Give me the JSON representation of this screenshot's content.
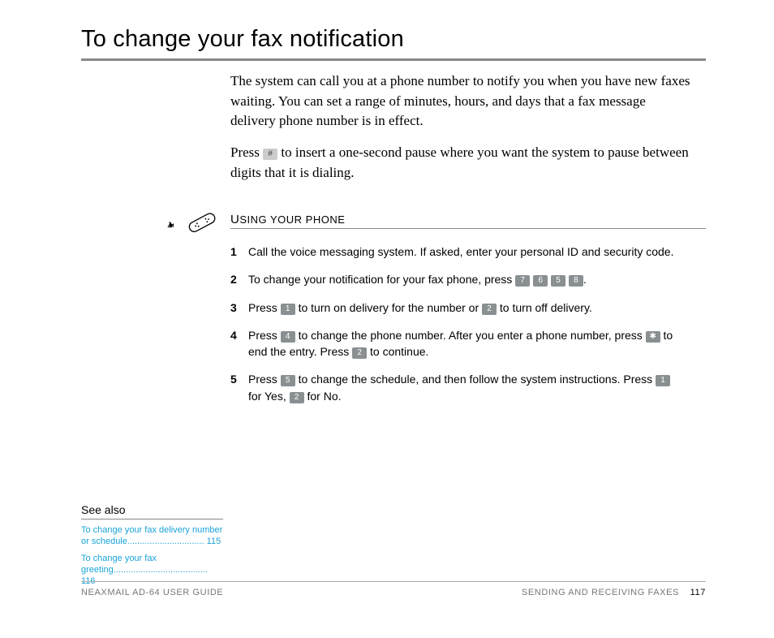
{
  "title": "To change your fax notification",
  "intro": {
    "p1": "The system can call you at a phone number to notify you when you have new faxes waiting. You can set a range of minutes, hours, and days that a fax message delivery phone number is in effect.",
    "p2a": "Press ",
    "key_hash": "#",
    "p2b": " to insert a one-second pause where you want the system to pause between digits that it is dialing."
  },
  "using_heading_cap": "U",
  "using_heading_rest": "SING YOUR PHONE",
  "steps": [
    {
      "num": "1",
      "parts": [
        {
          "t": "Call the voice messaging system. If asked, enter your personal ID and security code."
        }
      ]
    },
    {
      "num": "2",
      "parts": [
        {
          "t": "To change your notification for your fax phone, press "
        },
        {
          "k": "7"
        },
        {
          "t": " "
        },
        {
          "k": "6"
        },
        {
          "t": " "
        },
        {
          "k": "5"
        },
        {
          "t": " "
        },
        {
          "k": "8"
        },
        {
          "t": "."
        }
      ]
    },
    {
      "num": "3",
      "parts": [
        {
          "t": "Press "
        },
        {
          "k": "1"
        },
        {
          "t": " to turn on delivery for the number or "
        },
        {
          "k": "2"
        },
        {
          "t": " to turn off delivery."
        }
      ]
    },
    {
      "num": "4",
      "parts": [
        {
          "t": "Press "
        },
        {
          "k": "4"
        },
        {
          "t": " to change the phone number. After you enter a phone number, press "
        },
        {
          "k": "✱"
        },
        {
          "t": " to end the entry. Press "
        },
        {
          "k": "2"
        },
        {
          "t": " to continue."
        }
      ]
    },
    {
      "num": "5",
      "parts": [
        {
          "t": "Press "
        },
        {
          "k": "5"
        },
        {
          "t": " to change the schedule, and then follow the system instructions. Press "
        },
        {
          "k": "1"
        },
        {
          "t": " for Yes, "
        },
        {
          "k": "2"
        },
        {
          "t": " for No."
        }
      ]
    }
  ],
  "see_also": {
    "title": "See also",
    "links": [
      "To change your fax delivery number or schedule............................... 115",
      "To change your fax greeting...................................... 116"
    ]
  },
  "footer": {
    "left": "NEAXMAIL AD-64 USER GUIDE",
    "right_section": "SENDING AND RECEIVING FAXES",
    "page": "117"
  }
}
